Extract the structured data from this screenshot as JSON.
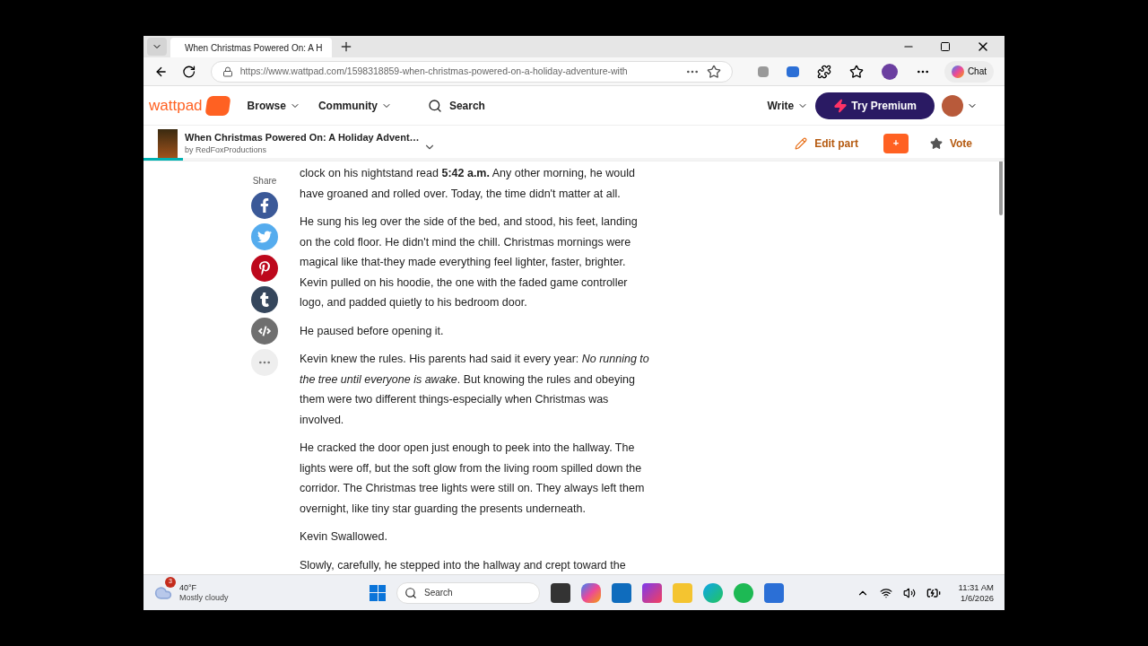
{
  "browser": {
    "tab_title": "When Christmas Powered On: A H",
    "url": "https://www.wattpad.com/1598318859-when-christmas-powered-on-a-holiday-adventure-with",
    "chat_label": "Chat"
  },
  "site_header": {
    "logo": "wattpad",
    "nav": [
      {
        "label": "Browse"
      },
      {
        "label": "Community"
      }
    ],
    "search": "Search",
    "write": "Write",
    "premium": "Try Premium"
  },
  "story_bar": {
    "title": "When Christmas Powered On: A Holiday Advent…",
    "author": "by RedFoxProductions",
    "edit": "Edit part",
    "add": "+",
    "vote": "Vote",
    "reading_progress": {
      "level": 0.046
    }
  },
  "share": {
    "label": "Share",
    "buttons": [
      {
        "kind": "facebook"
      },
      {
        "kind": "twitter"
      },
      {
        "kind": "pinterest"
      },
      {
        "kind": "tumblr"
      },
      {
        "kind": "embed"
      },
      {
        "kind": "more"
      }
    ]
  },
  "paragraphs": [
    "clock on his nightstand read **5:42 a.m.**  Any other morning, he would have groaned and rolled over. Today, the time didn't matter at all.",
    "He sung his leg over the side of the bed, and stood, his feet, landing on the cold floor. He didn't mind the chill. Christmas mornings were magical like that-they made everything feel lighter, faster, brighter. Kevin pulled on his hoodie, the one with the faded game controller logo, and padded quietly to his bedroom door.",
    "He paused before opening it.",
    "Kevin knew the rules. His parents had said it every year: *No running to the tree until everyone is awake*. But knowing the rules and obeying them were two different things-especially when Christmas was involved.",
    "He cracked the door open just enough to peek into the hallway. The lights were off, but the soft glow from the living room spilled down the corridor. The Christmas tree lights were still on. They always left them overnight, like tiny star guarding the presents underneath.",
    "Kevin Swallowed.",
    "Slowly, carefully, he stepped into the hallway and crept toward the"
  ],
  "taskbar": {
    "weather_badge": "3",
    "temperature": "40°F",
    "condition": "Mostly cloudy",
    "search": "Search",
    "time": "11:31 AM",
    "date": "1/6/2026"
  }
}
